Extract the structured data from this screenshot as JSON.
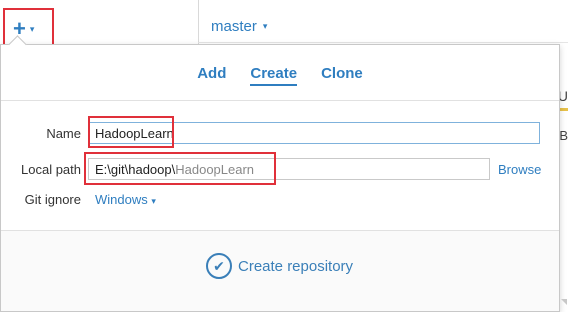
{
  "toolbar": {
    "add_glyph": "+",
    "caret": "▾"
  },
  "branch": {
    "name": "master",
    "caret": "▾"
  },
  "edge": {
    "text1": "U",
    "text2": "B"
  },
  "dialog": {
    "tabs": [
      {
        "label": "Add",
        "active": false
      },
      {
        "label": "Create",
        "active": true
      },
      {
        "label": "Clone",
        "active": false
      }
    ],
    "name_label": "Name",
    "name_value": "HadoopLearn",
    "local_path_label": "Local path",
    "local_path_prefix": "E:\\git\\hadoop\\",
    "local_path_suffix": "HadoopLearn",
    "browse_label": "Browse",
    "git_ignore_label": "Git ignore",
    "git_ignore_value": "Windows",
    "git_ignore_caret": "▾",
    "create_button_label": "Create repository",
    "check_glyph": "✔"
  },
  "colors": {
    "accent": "#2f7ec0",
    "highlight": "#e0303a"
  }
}
